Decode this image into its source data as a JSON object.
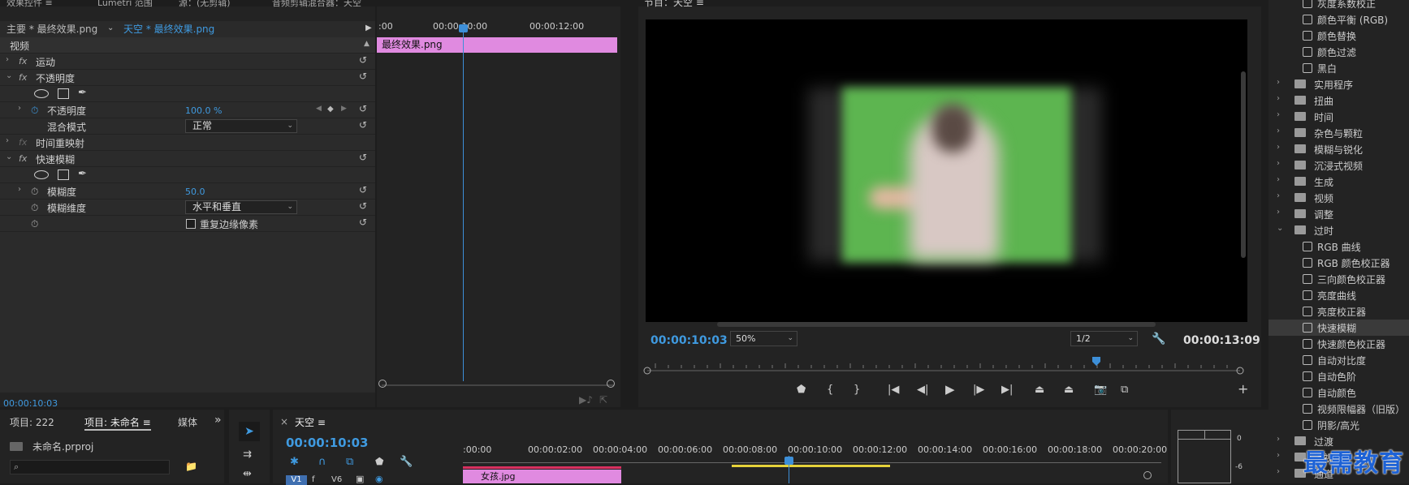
{
  "effect_controls": {
    "tabs": [
      "效果控件 ≡",
      "Lumetri 范围",
      "源：(无剪辑)",
      "音频剪辑混合器：天空"
    ],
    "master_clip": "主要 * 最终效果.png",
    "sequence_clip": "天空 * 最终效果.png",
    "section": "视频",
    "rows": [
      {
        "label": "运动"
      },
      {
        "label": "不透明度"
      },
      {
        "label": "不透明度",
        "value": "100.0 %"
      },
      {
        "label": "混合模式",
        "value": "正常"
      },
      {
        "label": "时间重映射"
      },
      {
        "label": "快速模糊"
      },
      {
        "label": "模糊度",
        "value": "50.0"
      },
      {
        "label": "模糊维度",
        "value": "水平和垂直"
      },
      {
        "label": "重复边缘像素"
      }
    ],
    "timecode": "00:00:10:03",
    "timeline_ticks": [
      ":00",
      "00:00:10:00",
      "00:00:12:00"
    ],
    "clip_name": "最终效果.png"
  },
  "program": {
    "title": "节目：天空 ≡",
    "current_timecode": "00:00:10:03",
    "zoom": "50%",
    "resolution": "1/2",
    "duration": "00:00:13:09"
  },
  "effects_panel": {
    "items": [
      {
        "label": "灰度系数校正",
        "type": "effect"
      },
      {
        "label": "颜色平衡 (RGB)",
        "type": "effect"
      },
      {
        "label": "颜色替换",
        "type": "effect"
      },
      {
        "label": "颜色过滤",
        "type": "effect"
      },
      {
        "label": "黑白",
        "type": "effect"
      },
      {
        "label": "实用程序",
        "type": "folder"
      },
      {
        "label": "扭曲",
        "type": "folder"
      },
      {
        "label": "时间",
        "type": "folder"
      },
      {
        "label": "杂色与颗粒",
        "type": "folder"
      },
      {
        "label": "模糊与锐化",
        "type": "folder"
      },
      {
        "label": "沉浸式视频",
        "type": "folder"
      },
      {
        "label": "生成",
        "type": "folder"
      },
      {
        "label": "视频",
        "type": "folder"
      },
      {
        "label": "调整",
        "type": "folder"
      },
      {
        "label": "过时",
        "type": "folder-open"
      },
      {
        "label": "RGB 曲线",
        "type": "effect"
      },
      {
        "label": "RGB 颜色校正器",
        "type": "effect"
      },
      {
        "label": "三向颜色校正器",
        "type": "effect"
      },
      {
        "label": "亮度曲线",
        "type": "effect"
      },
      {
        "label": "亮度校正器",
        "type": "effect"
      },
      {
        "label": "快速模糊",
        "type": "effect",
        "selected": true
      },
      {
        "label": "快速颜色校正器",
        "type": "effect"
      },
      {
        "label": "自动对比度",
        "type": "effect"
      },
      {
        "label": "自动色阶",
        "type": "effect"
      },
      {
        "label": "自动颜色",
        "type": "effect"
      },
      {
        "label": "视频限幅器（旧版）",
        "type": "effect"
      },
      {
        "label": "阴影/高光",
        "type": "effect"
      },
      {
        "label": "过渡",
        "type": "folder"
      },
      {
        "label": "透视",
        "type": "folder"
      },
      {
        "label": "通道",
        "type": "folder"
      }
    ]
  },
  "project": {
    "tab1": "项目: 222",
    "tab2": "项目: 未命名 ≡",
    "tab3": "媒体",
    "file": "未命名.prproj"
  },
  "sequence": {
    "tab": "天空 ≡",
    "timecode": "00:00:10:03",
    "ticks": [
      ":00:00",
      "00:00:02:00",
      "00:00:04:00",
      "00:00:06:00",
      "00:00:08:00",
      "00:00:10:00",
      "00:00:12:00",
      "00:00:14:00",
      "00:00:16:00",
      "00:00:18:00",
      "00:00:20:00"
    ],
    "track_v1": "V1",
    "track_v6": "V6",
    "clip": "女孩.jpg"
  },
  "meter": {
    "labels": [
      "0",
      "-6"
    ]
  },
  "watermark": "最需教育"
}
